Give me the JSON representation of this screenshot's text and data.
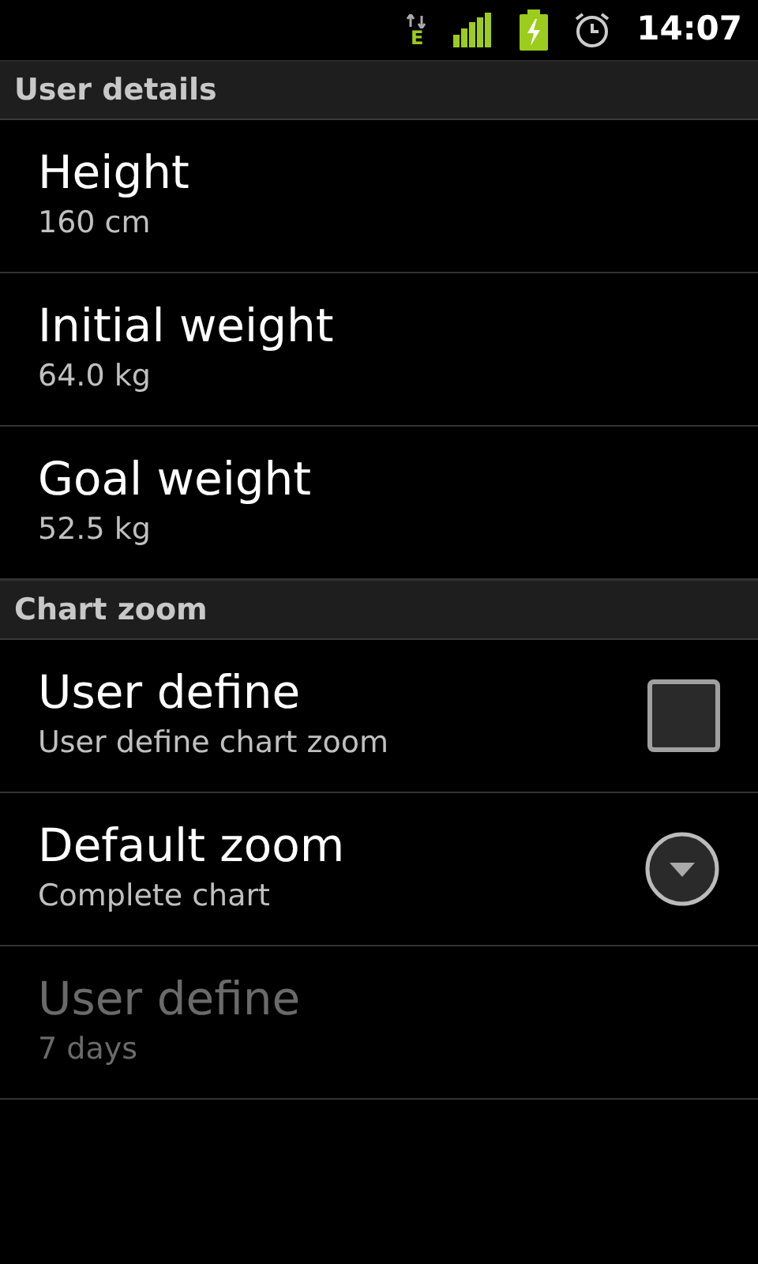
{
  "status_bar": {
    "network_type": "E",
    "time": "14:07"
  },
  "sections": [
    {
      "title": "User details",
      "items": [
        {
          "kind": "plain",
          "title": "Height",
          "summary": "160 cm",
          "disabled": false
        },
        {
          "kind": "plain",
          "title": "Initial weight",
          "summary": "64.0 kg",
          "disabled": false
        },
        {
          "kind": "plain",
          "title": "Goal weight",
          "summary": "52.5 kg",
          "disabled": false
        }
      ]
    },
    {
      "title": "Chart zoom",
      "items": [
        {
          "kind": "checkbox",
          "title": "User define",
          "summary": "User define chart zoom",
          "checked": false,
          "disabled": false
        },
        {
          "kind": "dropdown",
          "title": "Default zoom",
          "summary": "Complete chart",
          "disabled": false
        },
        {
          "kind": "plain",
          "title": "User define",
          "summary": "7 days",
          "disabled": true
        }
      ]
    }
  ]
}
